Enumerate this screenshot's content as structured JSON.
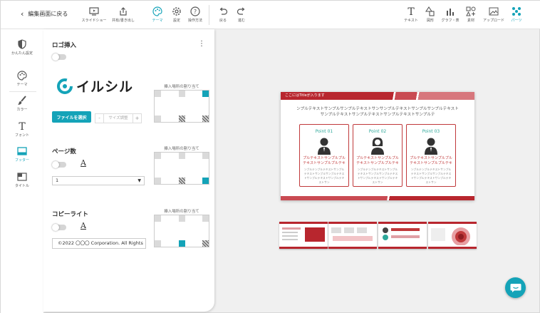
{
  "topbar": {
    "back_label": "編集画面に戻る",
    "tools": [
      {
        "label": "スライドショー",
        "icon": "slideshow-icon"
      },
      {
        "label": "共有/書き出し",
        "icon": "share-icon"
      },
      {
        "label": "テーマ",
        "icon": "palette-icon"
      },
      {
        "label": "設定",
        "icon": "gear-icon"
      },
      {
        "label": "操作方法",
        "icon": "help-icon"
      },
      {
        "label": "戻る",
        "icon": "undo-icon"
      },
      {
        "label": "進む",
        "icon": "redo-icon"
      }
    ],
    "right_tools": [
      {
        "label": "テキスト",
        "icon": "text-icon"
      },
      {
        "label": "図形",
        "icon": "shape-icon"
      },
      {
        "label": "グラフ・表",
        "icon": "chart-icon"
      },
      {
        "label": "素材",
        "icon": "assets-icon"
      },
      {
        "label": "アップロード",
        "icon": "upload-icon"
      },
      {
        "label": "パーツ",
        "icon": "parts-icon"
      }
    ]
  },
  "sidebar": {
    "items": [
      {
        "label": "かんたん設定"
      },
      {
        "label": "テーマ"
      },
      {
        "label": "カラー"
      },
      {
        "label": "フォント"
      },
      {
        "label": "フッター"
      },
      {
        "label": "タイトル"
      }
    ],
    "active_color": "#14a3b8"
  },
  "panel": {
    "logo": {
      "title": "ロゴ挿入",
      "logo_text": "イルシル",
      "file_button": "ファイルを選択",
      "size_minus": "-",
      "size_label": "サイズ調整",
      "size_plus": "+",
      "grid_label": "挿入場所の割り当て"
    },
    "page_number": {
      "title": "ページ数",
      "text_icon": "A",
      "select_value": "1",
      "grid_label": "挿入場所の割り当て"
    },
    "copyright": {
      "title": "コピーライト",
      "text_icon": "A",
      "input_value": "©2022 〇〇〇 Corporation. All Rights",
      "grid_label": "挿入場所の割り当て"
    }
  },
  "slide": {
    "header": "ここにはTitleが入ります",
    "body": "ンプルテキストサンプルサンプルテキストサンサンプルテキストサンプルサンプルテキストサンプルテキストサンプルテキストサンプルテキストサンプルテ",
    "cards": [
      {
        "point": "Point 01",
        "red": "プルテキストサンプルプルテキストサンプルプルテキ",
        "gray": "ンプルテンプルテキストサンプルテキストサンプルサンプルテキストサンプルテキストサンプルテキストサン"
      },
      {
        "point": "Point 02",
        "red": "プルテキストサンプルプルテキストサンプルプルテキ",
        "gray": "ンプルテンプルテキストサンプルテキストサンプルサンプルテキストサンプルテキストサンプルテキストサン"
      },
      {
        "point": "Point 03",
        "red": "プルテキストサンプルプルテキストサンプルプルテキ",
        "gray": "ンプルテンプルテキストサンプルテキストサンプルサンプルテキストサンプルテキストサンプルテキストサン"
      }
    ]
  },
  "colors": {
    "accent": "#14a3b8",
    "slide_red": "#b8262e",
    "point_teal": "#2ea89a"
  }
}
